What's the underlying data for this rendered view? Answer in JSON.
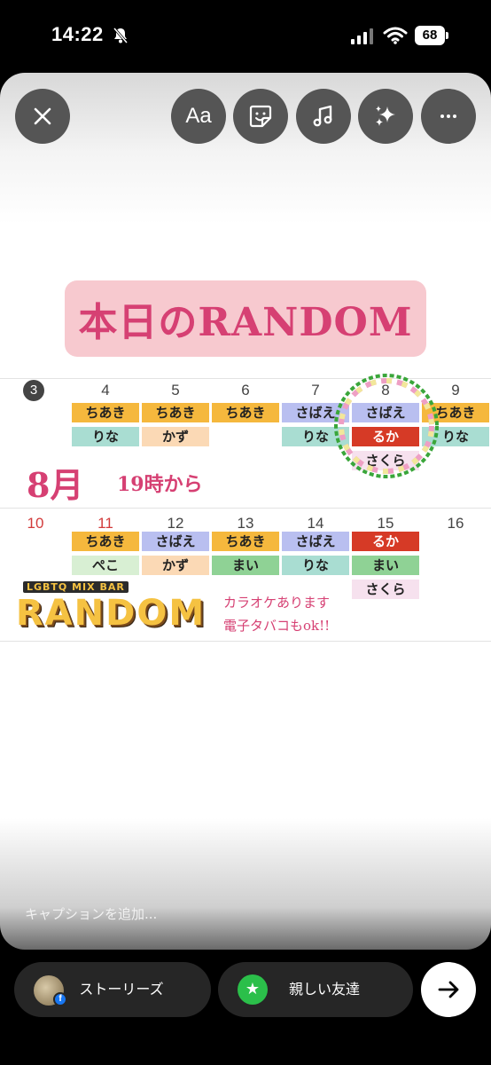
{
  "status_bar": {
    "time": "14:22",
    "battery": "68"
  },
  "toolbar": {
    "text_label": "Aa"
  },
  "story": {
    "title": "本日のRANDOM",
    "month": "8月",
    "from_time": "19時から",
    "week1": {
      "days": [
        "3",
        "4",
        "5",
        "6",
        "7",
        "8",
        "9"
      ],
      "row1": [
        "ちあき",
        "ちあき",
        "ちあき",
        "さばえ",
        "さばえ",
        "ちあき"
      ],
      "row2": [
        "りな",
        "かず",
        "りな",
        "るか",
        "りな"
      ],
      "row3": [
        "さくら"
      ]
    },
    "week2": {
      "days": [
        "10",
        "11",
        "12",
        "13",
        "14",
        "15",
        "16"
      ],
      "row1": [
        "ちあき",
        "さばえ",
        "ちあき",
        "さばえ",
        "るか"
      ],
      "row2": [
        "ぺこ",
        "かず",
        "まい",
        "りな",
        "まい"
      ],
      "row3": [
        "さくら"
      ]
    },
    "logo": {
      "small": "LGBTQ MIX BAR",
      "big": "RANDOM"
    },
    "notes": [
      "カラオケあります",
      "電子タバコもok!!"
    ]
  },
  "caption_placeholder": "キャプションを追加...",
  "bottom": {
    "stories_label": "ストーリーズ",
    "close_friends_label": "親しい友達"
  },
  "colors": {
    "accent": "#d64073",
    "title_bg": "#f7c9cf"
  }
}
